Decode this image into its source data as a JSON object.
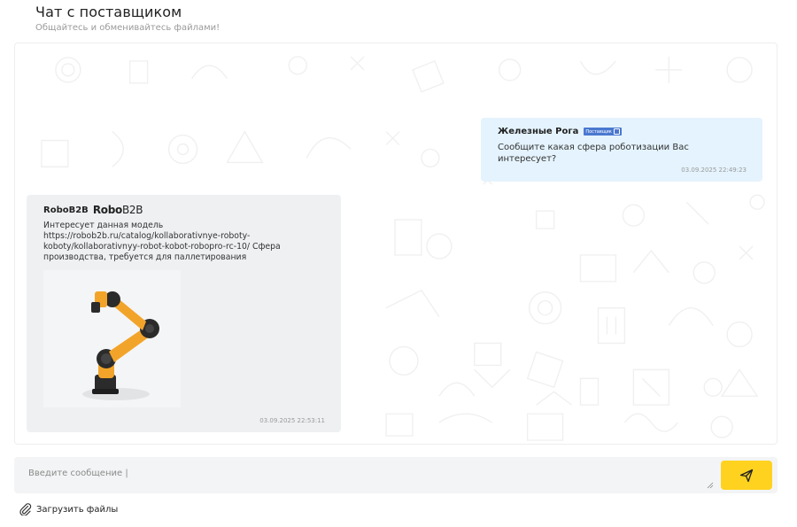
{
  "header": {
    "title": "Чат с поставщиком",
    "subtitle": "Общайтесь и обменивайтесь файлами!"
  },
  "messages": [
    {
      "author": "Железные Рога",
      "badge": "Поставщик",
      "text": "Сообщите какая сфера роботизации Вас интересует?",
      "time": "03.09.2025 22:49:23"
    },
    {
      "author": "RoboB2B",
      "logo_main": "Robo",
      "logo_light": "B2B",
      "text": "Интересует данная модель https://robob2b.ru/catalog/kollaborativnye-roboty-koboty/kollaborativnyy-robot-kobot-robopro-rc-10/ Сфера производства, требуется для паллетирования",
      "time": "03.09.2025 22:53:11"
    }
  ],
  "composer": {
    "placeholder": "Введите сообщение |",
    "send_icon": "send-icon"
  },
  "upload": {
    "label": "Загрузить файлы",
    "icon": "paperclip-icon"
  },
  "colors": {
    "outgoing_bubble": "#e4f3fd",
    "incoming_bubble": "#eef0f2",
    "send_button": "#ffd21f",
    "badge": "#4a78d0"
  }
}
